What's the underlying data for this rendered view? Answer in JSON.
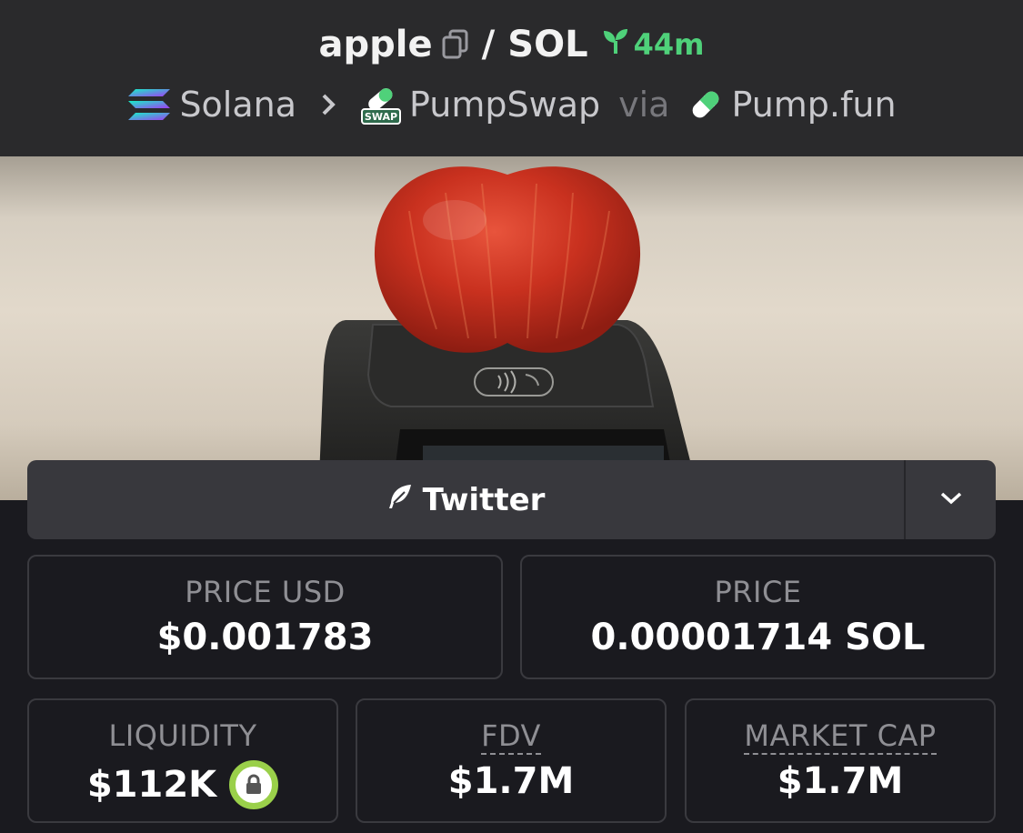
{
  "header": {
    "token": "apple",
    "separator": "/",
    "quote": "SOL",
    "age": "44m",
    "chain": "Solana",
    "dex": "PumpSwap",
    "dex_badge": "SWAP",
    "via": "via",
    "launchpad": "Pump.fun"
  },
  "social": {
    "twitter_label": "Twitter"
  },
  "stats": {
    "price_usd_label": "PRICE USD",
    "price_usd": "$0.001783",
    "price_label": "PRICE",
    "price": "0.00001714 SOL",
    "liquidity_label": "LIQUIDITY",
    "liquidity": "$112K",
    "fdv_label": "FDV",
    "fdv": "$1.7M",
    "mcap_label": "MARKET CAP",
    "mcap": "$1.7M"
  },
  "colors": {
    "accent_green": "#4fd17a",
    "lock_ring": "#9ad04a",
    "background": "#1a1a1f",
    "header_bg": "#2a2a2c"
  },
  "icons": [
    "copy-icon",
    "sprout-icon",
    "solana-icon",
    "chevron-right-icon",
    "pumpswap-icon",
    "pill-icon",
    "feather-icon",
    "chevron-down-icon",
    "lock-icon"
  ]
}
